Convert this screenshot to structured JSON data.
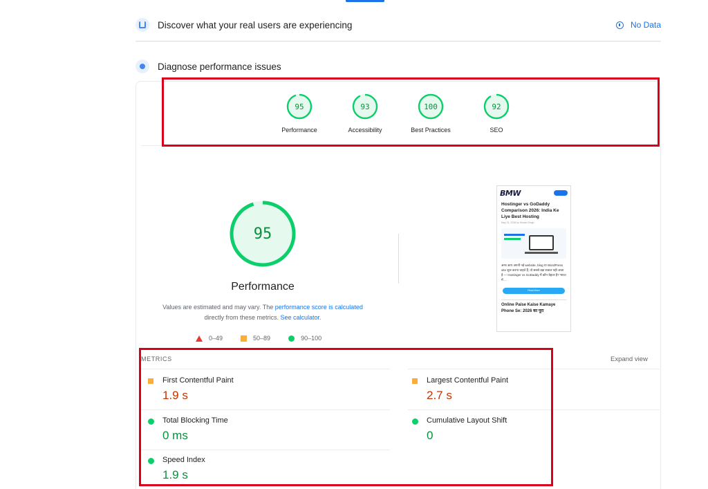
{
  "crux": {
    "title": "Discover what your real users are experiencing",
    "status": "No Data"
  },
  "diagnose": {
    "title": "Diagnose performance issues"
  },
  "categories": [
    {
      "score": "95",
      "label": "Performance",
      "value": 95
    },
    {
      "score": "93",
      "label": "Accessibility",
      "value": 93
    },
    {
      "score": "100",
      "label": "Best Practices",
      "value": 100
    },
    {
      "score": "92",
      "label": "SEO",
      "value": 92
    }
  ],
  "performance": {
    "score": "95",
    "value": 95,
    "label": "Performance",
    "desc_prefix": "Values are estimated and may vary. The",
    "desc_link1": "performance score is calculated",
    "desc_mid": "directly from these metrics.",
    "desc_link2": "See calculator."
  },
  "legend": {
    "fail": "0–49",
    "average": "50–89",
    "pass": "90–100"
  },
  "thumbnail": {
    "logo": "BMW",
    "title": "Hostinger vs GoDaddy Comparison 2026: India Ke Liye Best Hosting",
    "meta": "May 31, 2026 by Kishan Singh",
    "body": "अगर आप अपनी नई website, blog या WordPress site शुरू करना चाहते हैं, तो सबसे बड़ा सवाल यही आता है — Hostinger vs GoDaddy में कौन बेहतर है? भारत में ...",
    "cta": "Read More",
    "title2": "Online Paise Kaise Kamaye Phone Se: 2026 का पूरा"
  },
  "metrics": {
    "heading": "METRICS",
    "expand": "Expand view",
    "items": [
      {
        "name": "First Contentful Paint",
        "value": "1.9 s",
        "status": "average"
      },
      {
        "name": "Largest Contentful Paint",
        "value": "2.7 s",
        "status": "average"
      },
      {
        "name": "Total Blocking Time",
        "value": "0 ms",
        "status": "pass"
      },
      {
        "name": "Cumulative Layout Shift",
        "value": "0",
        "status": "pass"
      },
      {
        "name": "Speed Index",
        "value": "1.9 s",
        "status": "pass"
      }
    ]
  },
  "colors": {
    "pass": "#0cce6b",
    "average": "#fbad3a",
    "fail": "#e53935",
    "accent": "#1a73e8",
    "highlight": "#d9001b"
  }
}
